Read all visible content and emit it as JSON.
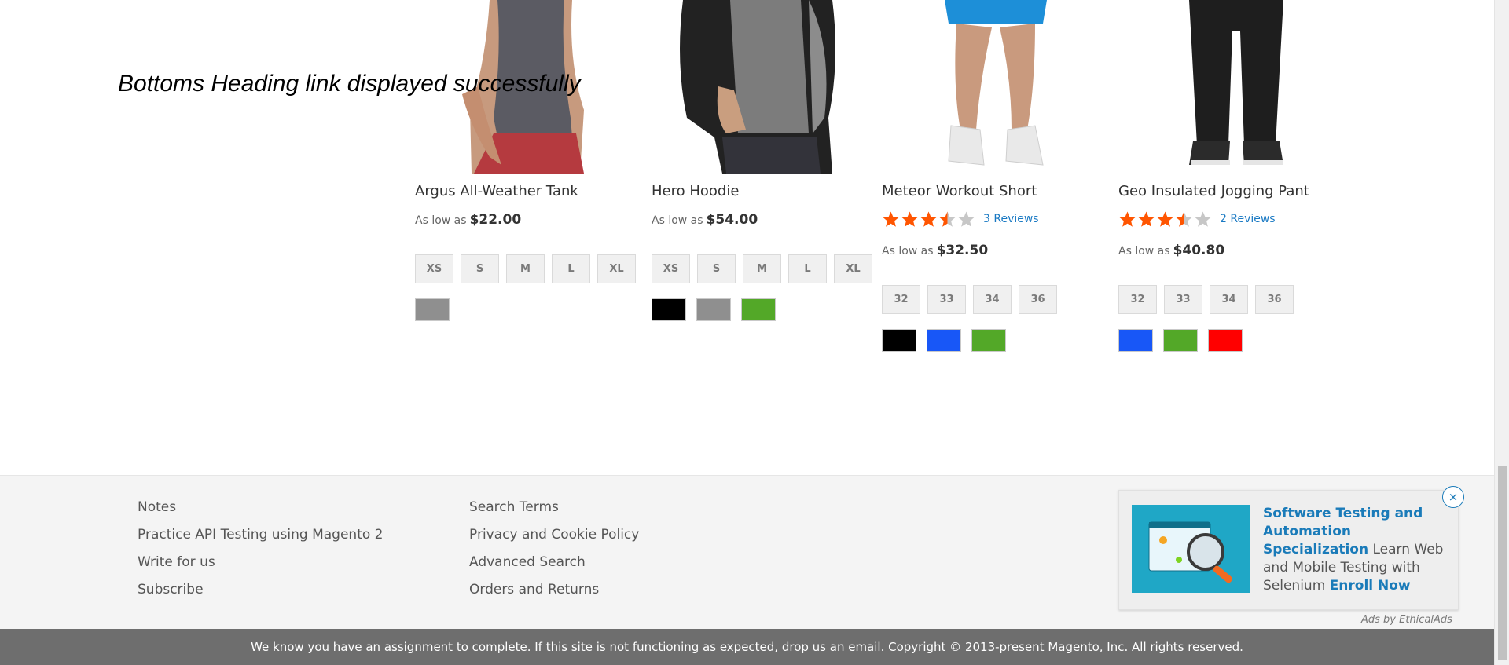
{
  "overlay_message": "Bottoms Heading link displayed successfully",
  "products": [
    {
      "name": "Argus All-Weather Tank",
      "price_label": "As low as",
      "price": "$22.00",
      "sizes": [
        "XS",
        "S",
        "M",
        "L",
        "XL"
      ],
      "colors": [
        "#8f8f8f"
      ]
    },
    {
      "name": "Hero Hoodie",
      "price_label": "As low as",
      "price": "$54.00",
      "sizes": [
        "XS",
        "S",
        "M",
        "L",
        "XL"
      ],
      "colors": [
        "#000000",
        "#8f8f8f",
        "#53a828"
      ]
    },
    {
      "name": "Meteor Workout Short",
      "rating": 3.5,
      "reviews": "3 Reviews",
      "price_label": "As low as",
      "price": "$32.50",
      "sizes": [
        "32",
        "33",
        "34",
        "36"
      ],
      "colors": [
        "#000000",
        "#1857f7",
        "#53a828"
      ]
    },
    {
      "name": "Geo Insulated Jogging Pant",
      "rating": 3.5,
      "reviews": "2 Reviews",
      "price_label": "As low as",
      "price": "$40.80",
      "sizes": [
        "32",
        "33",
        "34",
        "36"
      ],
      "colors": [
        "#1857f7",
        "#53a828",
        "#ff0000"
      ]
    }
  ],
  "footer": {
    "col1": [
      "Notes",
      "Practice API Testing using Magento 2",
      "Write for us",
      "Subscribe"
    ],
    "col2": [
      "Search Terms",
      "Privacy and Cookie Policy",
      "Advanced Search",
      "Orders and Returns"
    ]
  },
  "ad": {
    "title": "Software Testing and Automation Specialization",
    "body": "Learn Web and Mobile Testing with Selenium",
    "cta": "Enroll Now",
    "by": "Ads by EthicalAds",
    "close": "×"
  },
  "copyright": "We know you have an assignment to complete. If this site is not functioning as expected, drop us an email. Copyright © 2013-present Magento, Inc. All rights reserved.",
  "colors": {
    "star": "#ff5501",
    "star_empty": "#c7c7c7",
    "link": "#1979c3"
  }
}
